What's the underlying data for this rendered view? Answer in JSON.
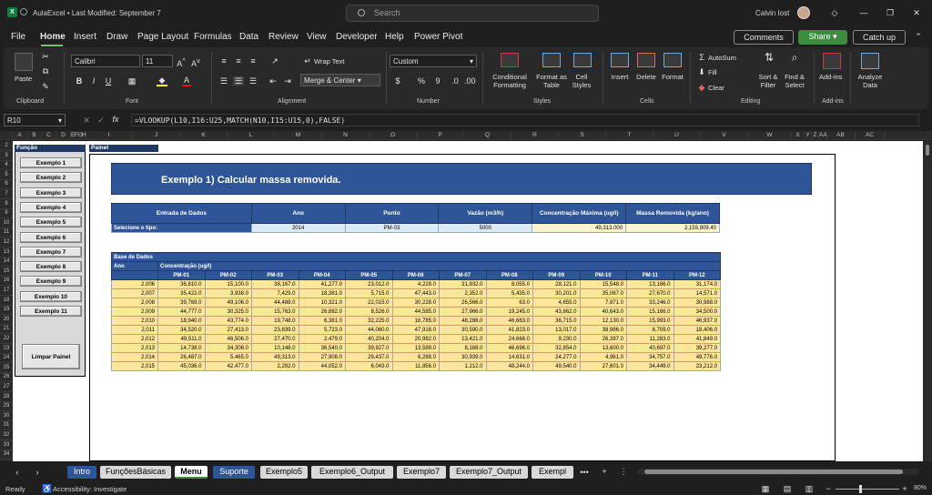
{
  "title_bar": {
    "file_title": "AulaExcel • Last Modified: September 7",
    "search_placeholder": "Search",
    "user_name": "Calvin Iost"
  },
  "menu": {
    "items": [
      "File",
      "Home",
      "Insert",
      "Draw",
      "Page Layout",
      "Formulas",
      "Data",
      "Review",
      "View",
      "Developer",
      "Help",
      "Power Pivot"
    ],
    "active": "Home",
    "comments": "Comments",
    "share": "Share",
    "catch_up": "Catch up"
  },
  "ribbon": {
    "clipboard": {
      "paste": "Paste",
      "label": "Clipboard"
    },
    "font": {
      "name": "Calibri",
      "size": "11",
      "label": "Font"
    },
    "alignment": {
      "wrap": "Wrap Text",
      "merge": "Merge & Center",
      "label": "Alignment"
    },
    "number": {
      "format": "Custom",
      "label": "Number"
    },
    "styles": {
      "conditional": "Conditional Formatting",
      "format_as_table": "Format as Table",
      "cell_styles": "Cell Styles",
      "label": "Styles"
    },
    "cells": {
      "insert": "Insert",
      "delete": "Delete",
      "format": "Format",
      "label": "Cells"
    },
    "editing": {
      "autosum": "AutoSum",
      "fill": "Fill",
      "clear": "Clear",
      "sort": "Sort & Filter",
      "find": "Find & Select",
      "label": "Editing"
    },
    "addins": {
      "addins": "Add-ins",
      "label": "Add-ins"
    },
    "analyze": {
      "label": "Analyze Data"
    }
  },
  "formula_bar": {
    "name_box": "R10",
    "fx": "fx",
    "formula": "=VLOOKUP(L10,I16:U25,MATCH(N10,I15:U15,0),FALSE)"
  },
  "columns": [
    "A",
    "B",
    "C",
    "D",
    "E",
    "F",
    "G",
    "H",
    "I",
    "J",
    "K",
    "L",
    "M",
    "N",
    "O",
    "P",
    "Q",
    "R",
    "S",
    "T",
    "U",
    "V",
    "W",
    "X",
    "Y",
    "Z",
    "AA",
    "AB",
    "AC"
  ],
  "rows": [
    "2",
    "3",
    "4",
    "5",
    "6",
    "7",
    "8",
    "9",
    "10",
    "11",
    "12",
    "13",
    "14",
    "15",
    "16",
    "17",
    "18",
    "19",
    "20",
    "21",
    "22",
    "23",
    "24",
    "25",
    "26",
    "27",
    "28",
    "29",
    "30",
    "31",
    "32",
    "33",
    "34"
  ],
  "funcao_panel": {
    "title": "Função",
    "buttons": [
      "Exemplo 1",
      "Exemplo 2",
      "Exemplo 3",
      "Exemplo 4",
      "Exemplo 5",
      "Exemplo 6",
      "Exemplo 7",
      "Exemplo 8",
      "Exemplo 9",
      "Exemplo 10",
      "Exemplo 11"
    ],
    "clear": "Limpar Painel"
  },
  "painel": {
    "title": "Painel",
    "banner": "Exemplo 1) Calcular massa removida.",
    "input_headers": [
      "Entrada de Dados",
      "Ano",
      "Ponto",
      "Vazão (m3/h)",
      "Concentração Máxima (ug/l)",
      "Massa Removida (kg/ano)"
    ],
    "input_row": [
      "Selecione o tipo:",
      "2014",
      "PM-03",
      "5000",
      "49,313.000",
      "2,159,909.40"
    ],
    "db_title": "Base de Dados",
    "db_ano": "Ano",
    "db_conc": "Concentração (ug/l)",
    "db_points": [
      "PM-01",
      "PM-02",
      "PM-03",
      "PM-04",
      "PM-05",
      "PM-06",
      "PM-07",
      "PM-08",
      "PM-09",
      "PM-10",
      "PM-11",
      "PM-12"
    ],
    "db_rows": [
      [
        "2,006",
        "36,810.0",
        "15,100.0",
        "38,167.0",
        "41,277.0",
        "23,012.0",
        "4,228.0",
        "31,932.0",
        "8,055.0",
        "28,121.0",
        "15,548.0",
        "13,166.0",
        "31,174.0"
      ],
      [
        "2,007",
        "35,422.0",
        "3,938.0",
        "7,429.0",
        "18,381.0",
        "5,715.0",
        "47,443.0",
        "2,352.0",
        "5,435.0",
        "30,201.0",
        "35,067.0",
        "27,670.0",
        "14,571.0"
      ],
      [
        "2,008",
        "39,769.0",
        "49,106.0",
        "44,488.0",
        "10,321.0",
        "22,015.0",
        "30,228.0",
        "26,566.0",
        "63.0",
        "4,655.0",
        "7,871.0",
        "33,246.0",
        "30,988.0"
      ],
      [
        "2,009",
        "44,777.0",
        "30,325.0",
        "15,763.0",
        "26,882.0",
        "8,526.0",
        "44,585.0",
        "27,966.0",
        "19,245.0",
        "43,862.0",
        "40,643.0",
        "15,166.0",
        "34,500.0"
      ],
      [
        "2,010",
        "18,940.0",
        "43,774.0",
        "19,748.0",
        "6,381.0",
        "32,225.0",
        "16,785.0",
        "48,288.0",
        "46,663.0",
        "36,715.0",
        "12,130.0",
        "15,993.0",
        "46,937.0"
      ],
      [
        "2,011",
        "34,520.0",
        "27,413.0",
        "23,839.0",
        "5,723.0",
        "44,060.0",
        "47,918.0",
        "30,590.0",
        "41,823.0",
        "13,017.0",
        "38,986.0",
        "8,709.0",
        "18,406.0"
      ],
      [
        "2,012",
        "49,511.0",
        "46,506.0",
        "27,470.0",
        "2,479.0",
        "40,204.0",
        "20,982.0",
        "13,421.0",
        "24,666.0",
        "9,230.0",
        "26,397.0",
        "11,283.0",
        "41,849.0"
      ],
      [
        "2,013",
        "14,738.0",
        "34,308.0",
        "10,148.0",
        "36,540.0",
        "39,927.0",
        "13,589.0",
        "8,188.0",
        "46,696.0",
        "32,854.0",
        "13,600.0",
        "40,697.0",
        "39,277.0"
      ],
      [
        "2,014",
        "26,487.0",
        "5,465.0",
        "49,313.0",
        "27,908.0",
        "29,437.0",
        "6,288.0",
        "30,939.0",
        "14,631.0",
        "24,277.0",
        "4,961.0",
        "34,757.0",
        "49,776.0"
      ],
      [
        "2,015",
        "45,036.0",
        "42,477.0",
        "2,292.0",
        "44,052.0",
        "6,043.0",
        "11,856.0",
        "1,212.0",
        "48,244.0",
        "49,540.0",
        "27,601.0",
        "34,449.0",
        "23,212.0"
      ]
    ]
  },
  "sheet_tabs": [
    "Intro",
    "FunçõesBásicas",
    "Menu",
    "Suporte",
    "Exemplo5",
    "Exemplo6_Output",
    "Exemplo7",
    "Exemplo7_Output",
    "Exempl"
  ],
  "active_tab": "Menu",
  "status": {
    "ready": "Ready",
    "accessibility": "Accessibility: Investigate",
    "zoom": "80%"
  },
  "colors": {
    "accent_green": "#3d8c40",
    "header_blue": "#2e5597",
    "data_yellow": "#ffe699",
    "input_blue": "#ddebf7",
    "input_yellow": "#fff2cc"
  }
}
